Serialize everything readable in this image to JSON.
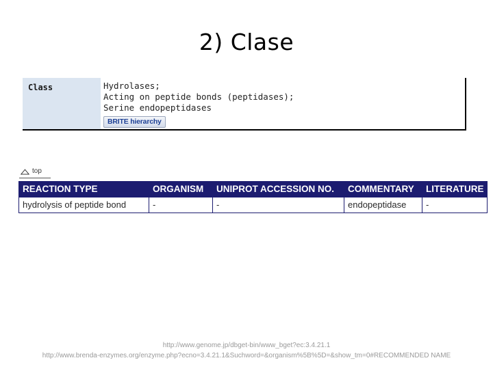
{
  "slide": {
    "title": "2) Clase"
  },
  "class_panel": {
    "label": "Class",
    "lines": [
      "Hydrolases;",
      "Acting on peptide bonds (peptidases);",
      "Serine endopeptidases"
    ],
    "brite_button_label": "BRITE hierarchy",
    "cell_background": "#dbe5f1",
    "border_color": "#000000",
    "button_text_color": "#1c3f94"
  },
  "top_anchor": {
    "label": "top",
    "icon": "triangle-up-icon"
  },
  "reaction_table": {
    "header_background": "#1c1c70",
    "header_text_color": "#ffffff",
    "columns": [
      "REACTION TYPE",
      "ORGANISM",
      "UNIPROT ACCESSION NO.",
      "COMMENTARY",
      "LITERATURE"
    ],
    "rows": [
      {
        "reaction_type": "hydrolysis of peptide bond",
        "organism": "-",
        "uniprot_accession_no": "-",
        "commentary": "endopeptidase",
        "literature": "-"
      }
    ]
  },
  "footer": {
    "urls": [
      "http://www.genome.jp/dbget-bin/www_bget?ec:3.4.21.1",
      "http://www.brenda-enzymes.org/enzyme.php?ecno=3.4.21.1&Suchword=&organism%5B%5D=&show_tm=0#RECOMMENDED NAME"
    ]
  }
}
